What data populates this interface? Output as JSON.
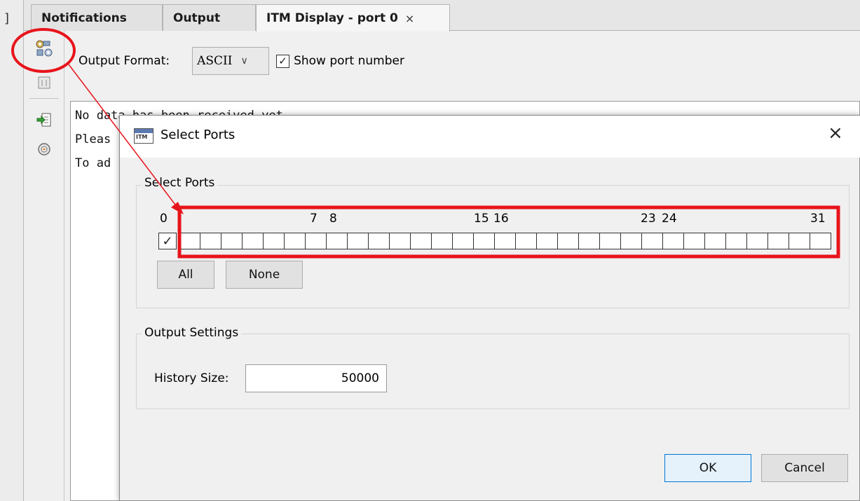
{
  "ide": {
    "left_bracket": "]",
    "tabs": [
      {
        "label": "Notifications"
      },
      {
        "label": "Output"
      },
      {
        "label": "ITM Display - port 0",
        "close": "×"
      }
    ],
    "output_format_label": "Output Format:",
    "output_format_value": "ASCII",
    "show_port_number_label": "Show port number",
    "show_port_number_checked": true,
    "output_lines": [
      "No data has been received yet.",
      "Pleas",
      "To ad"
    ],
    "toolbar_icons": [
      "configure-ports-icon",
      "clear-icon",
      "export-icon",
      "timestamp-icon"
    ]
  },
  "dialog": {
    "title": "Select Ports",
    "close": "×",
    "icon_label": "ITM",
    "select_ports_group": "Select Ports",
    "port_labels": [
      "0",
      "7",
      "8",
      "15",
      "16",
      "23",
      "24",
      "31"
    ],
    "port_count": 32,
    "checked_ports": [
      0
    ],
    "all_button": "All",
    "none_button": "None",
    "output_settings_group": "Output Settings",
    "history_size_label": "History Size:",
    "history_size_value": "50000",
    "ok_button": "OK",
    "cancel_button": "Cancel"
  },
  "annotation": {
    "highlight_color": "#e8141b"
  }
}
